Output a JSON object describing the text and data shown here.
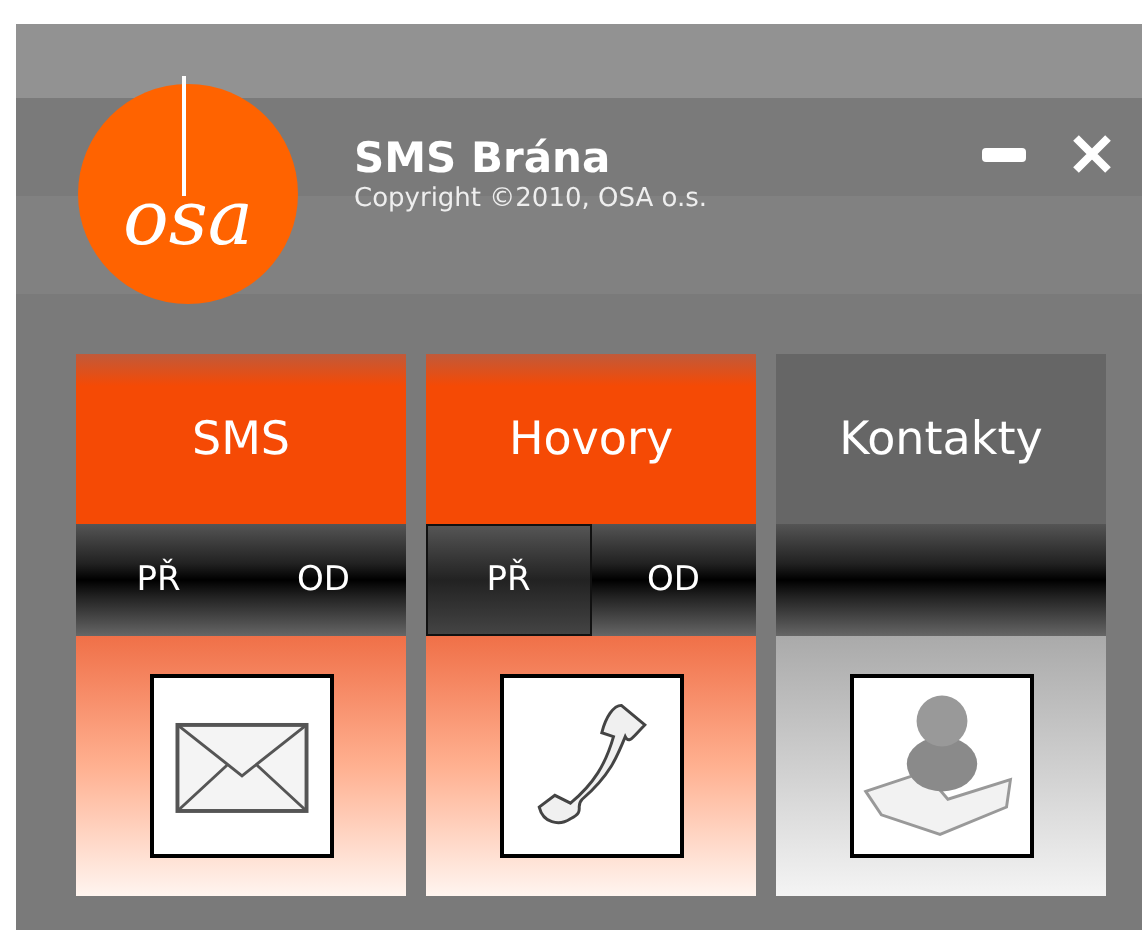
{
  "window": {
    "logo_text": "osa",
    "title": "SMS Brána",
    "subtitle": "Copyright ©2010, OSA o.s."
  },
  "tiles": [
    {
      "label": "SMS",
      "active": true,
      "kind": "envelope",
      "subtabs": [
        {
          "label": "PŘ",
          "selected": false
        },
        {
          "label": "OD",
          "selected": false
        }
      ]
    },
    {
      "label": "Hovory",
      "active": true,
      "kind": "phone",
      "subtabs": [
        {
          "label": "PŘ",
          "selected": true
        },
        {
          "label": "OD",
          "selected": false
        }
      ]
    },
    {
      "label": "Kontakty",
      "active": false,
      "kind": "contacts"
    }
  ]
}
